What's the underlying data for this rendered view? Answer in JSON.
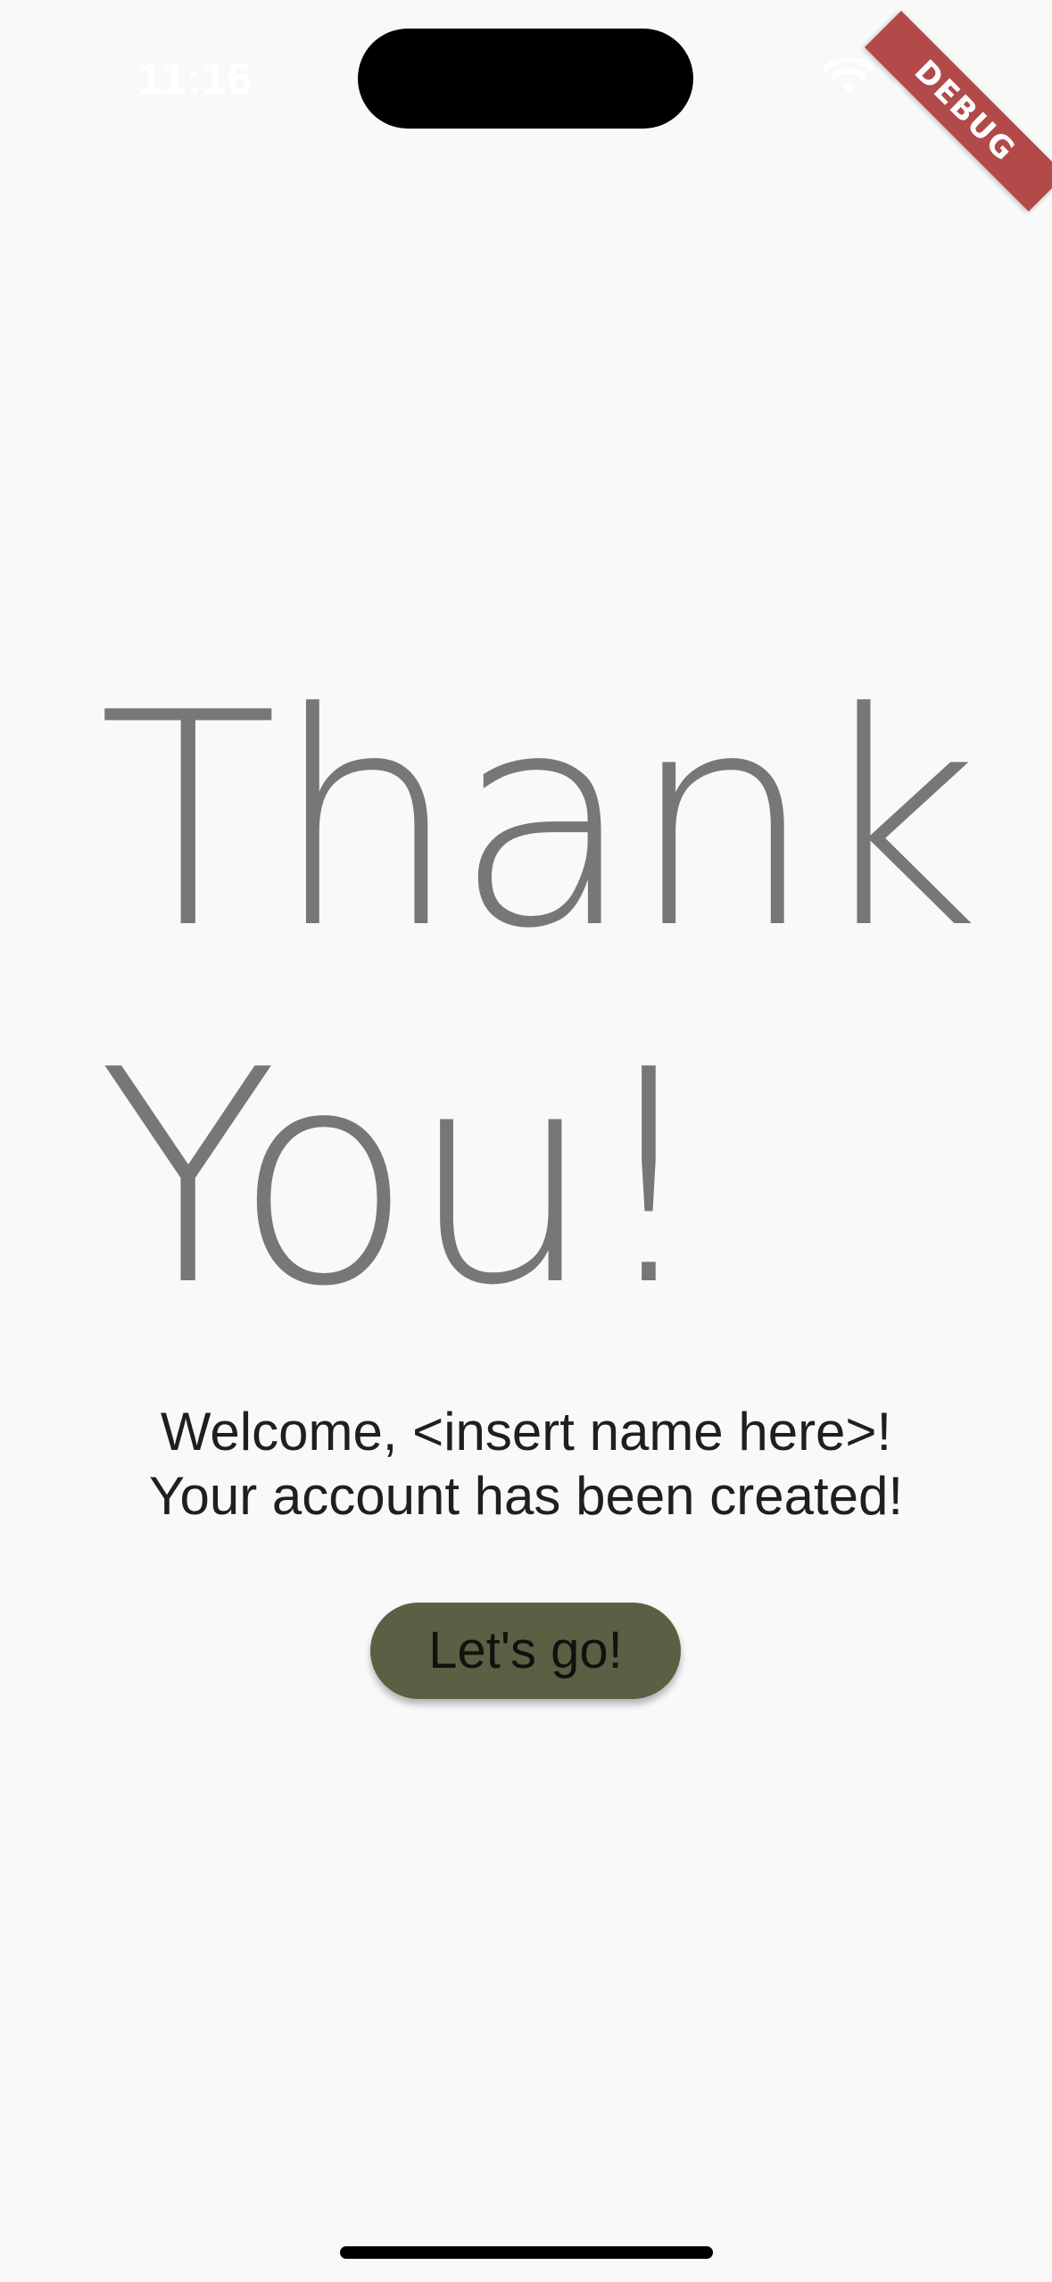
{
  "status_bar": {
    "time": "11:16",
    "wifi_icon": "wifi-icon",
    "battery_icon": "battery-icon"
  },
  "debug_banner": {
    "label": "DEBUG",
    "color": "#b24a4a"
  },
  "headline": {
    "line1": "Thank",
    "line2": "You!",
    "color": "#777777"
  },
  "message": {
    "line1": "Welcome, <insert name here>!",
    "line2": "Your account has been created!"
  },
  "cta": {
    "label": "Let's go!",
    "color": "#5b6044"
  },
  "colors": {
    "background": "#f9f9f9"
  }
}
